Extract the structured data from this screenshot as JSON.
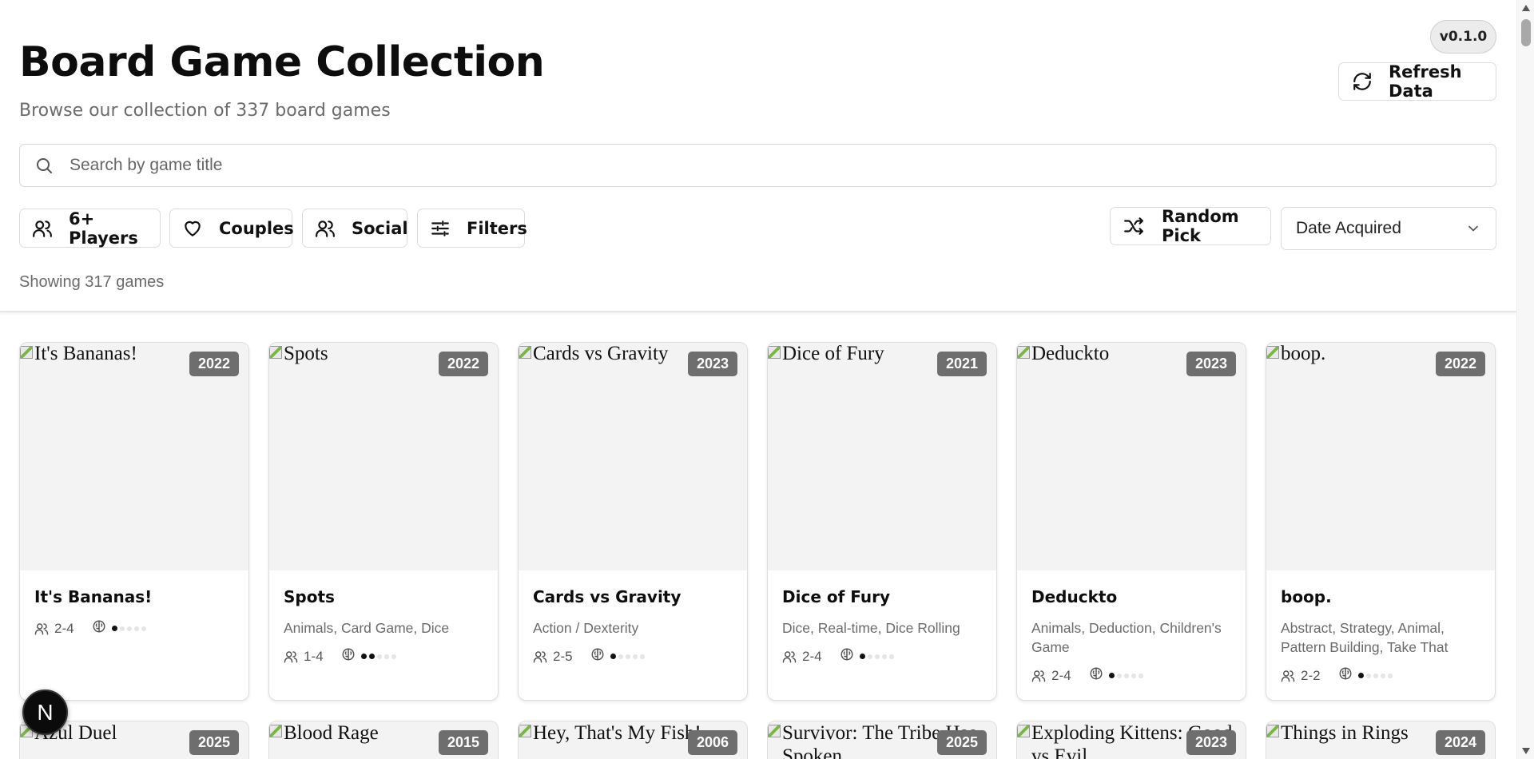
{
  "header": {
    "title": "Board Game Collection",
    "subtitle": "Browse our collection of 337 board games",
    "version": "v0.1.0",
    "refresh_label": "Refresh Data"
  },
  "search": {
    "placeholder": "Search by game title",
    "value": ""
  },
  "filters": {
    "chips": [
      {
        "label": "6+ Players",
        "icon": "users-icon"
      },
      {
        "label": "Couples",
        "icon": "heart-icon"
      },
      {
        "label": "Social",
        "icon": "users-icon"
      },
      {
        "label": "Filters",
        "icon": "sliders-icon"
      }
    ],
    "random_label": "Random Pick",
    "sort_selected": "Date Acquired"
  },
  "results": {
    "showing": "Showing 317 games"
  },
  "games": [
    {
      "title": "It's Bananas!",
      "year": "2022",
      "categories": "",
      "players": "2-4",
      "complexity": 1,
      "complexity_max": 5
    },
    {
      "title": "Spots",
      "year": "2022",
      "categories": "Animals, Card Game, Dice",
      "players": "1-4",
      "complexity": 2,
      "complexity_max": 5
    },
    {
      "title": "Cards vs Gravity",
      "year": "2023",
      "categories": "Action / Dexterity",
      "players": "2-5",
      "complexity": 1,
      "complexity_max": 5
    },
    {
      "title": "Dice of Fury",
      "year": "2021",
      "categories": "Dice, Real-time, Dice Rolling",
      "players": "2-4",
      "complexity": 1,
      "complexity_max": 5
    },
    {
      "title": "Deduckto",
      "year": "2023",
      "categories": "Animals, Deduction, Children's Game",
      "players": "2-4",
      "complexity": 1,
      "complexity_max": 5
    },
    {
      "title": "boop.",
      "year": "2022",
      "categories": "Abstract, Strategy, Animal, Pattern Building, Take That",
      "players": "2-2",
      "complexity": 1,
      "complexity_max": 5
    }
  ],
  "games_row2": [
    {
      "title": "Azul Duel",
      "year": "2025"
    },
    {
      "title": "Blood Rage",
      "year": "2015"
    },
    {
      "title": "Hey, That's My Fish!",
      "year": "2006"
    },
    {
      "title": "Survivor: The Tribe Has Spoken",
      "year": "2025"
    },
    {
      "title": "Exploding Kittens: Good vs Evil",
      "year": "2023"
    },
    {
      "title": "Things in Rings",
      "year": "2024"
    }
  ],
  "floating_badge": "N"
}
